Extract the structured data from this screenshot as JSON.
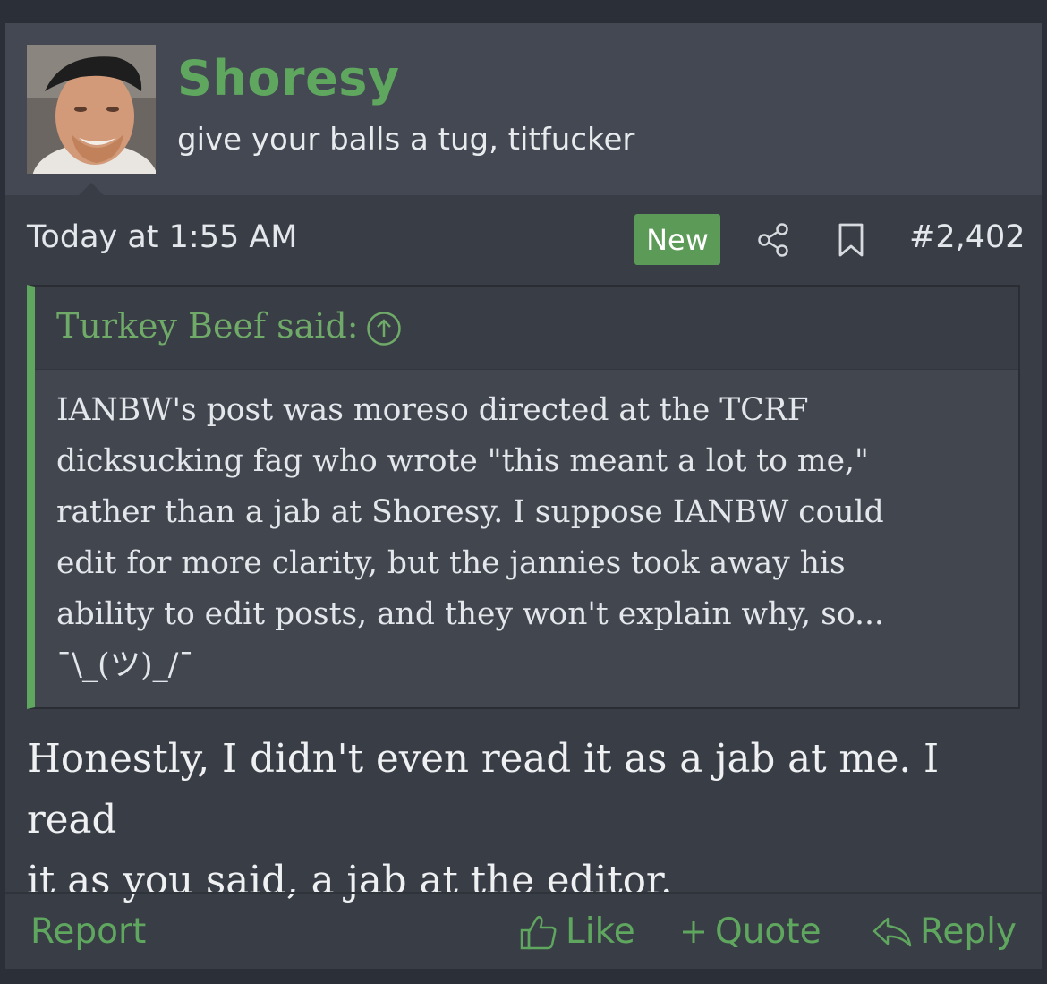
{
  "user": {
    "name": "Shoresy",
    "title": "give your balls a tug, titfucker"
  },
  "meta": {
    "date": "Today at 1:55 AM",
    "badge": "New",
    "post_number": "#2,402"
  },
  "quote": {
    "author": "Turkey Beef said:",
    "body": "IANBW's post was moreso directed at the TCRF\ndicksucking fag who wrote \"this meant a lot to me,\"\nrather than a jab at Shoresy. I suppose IANBW could\nedit for more clarity, but the jannies took away his\nability to edit posts, and they won't explain why, so...\n¯\\_(ツ)_/¯"
  },
  "message": {
    "text": "Honestly, I didn't even read it as a jab at me. I read\nit as you said, a jab at the editor."
  },
  "actions": {
    "report": "Report",
    "like": "Like",
    "quote": "Quote",
    "reply": "Reply"
  },
  "colors": {
    "accent": "#5fa65f",
    "badge": "#5c9a57",
    "header_bg": "#434852",
    "post_bg": "#393d46",
    "page_bg": "#2b2f37"
  }
}
